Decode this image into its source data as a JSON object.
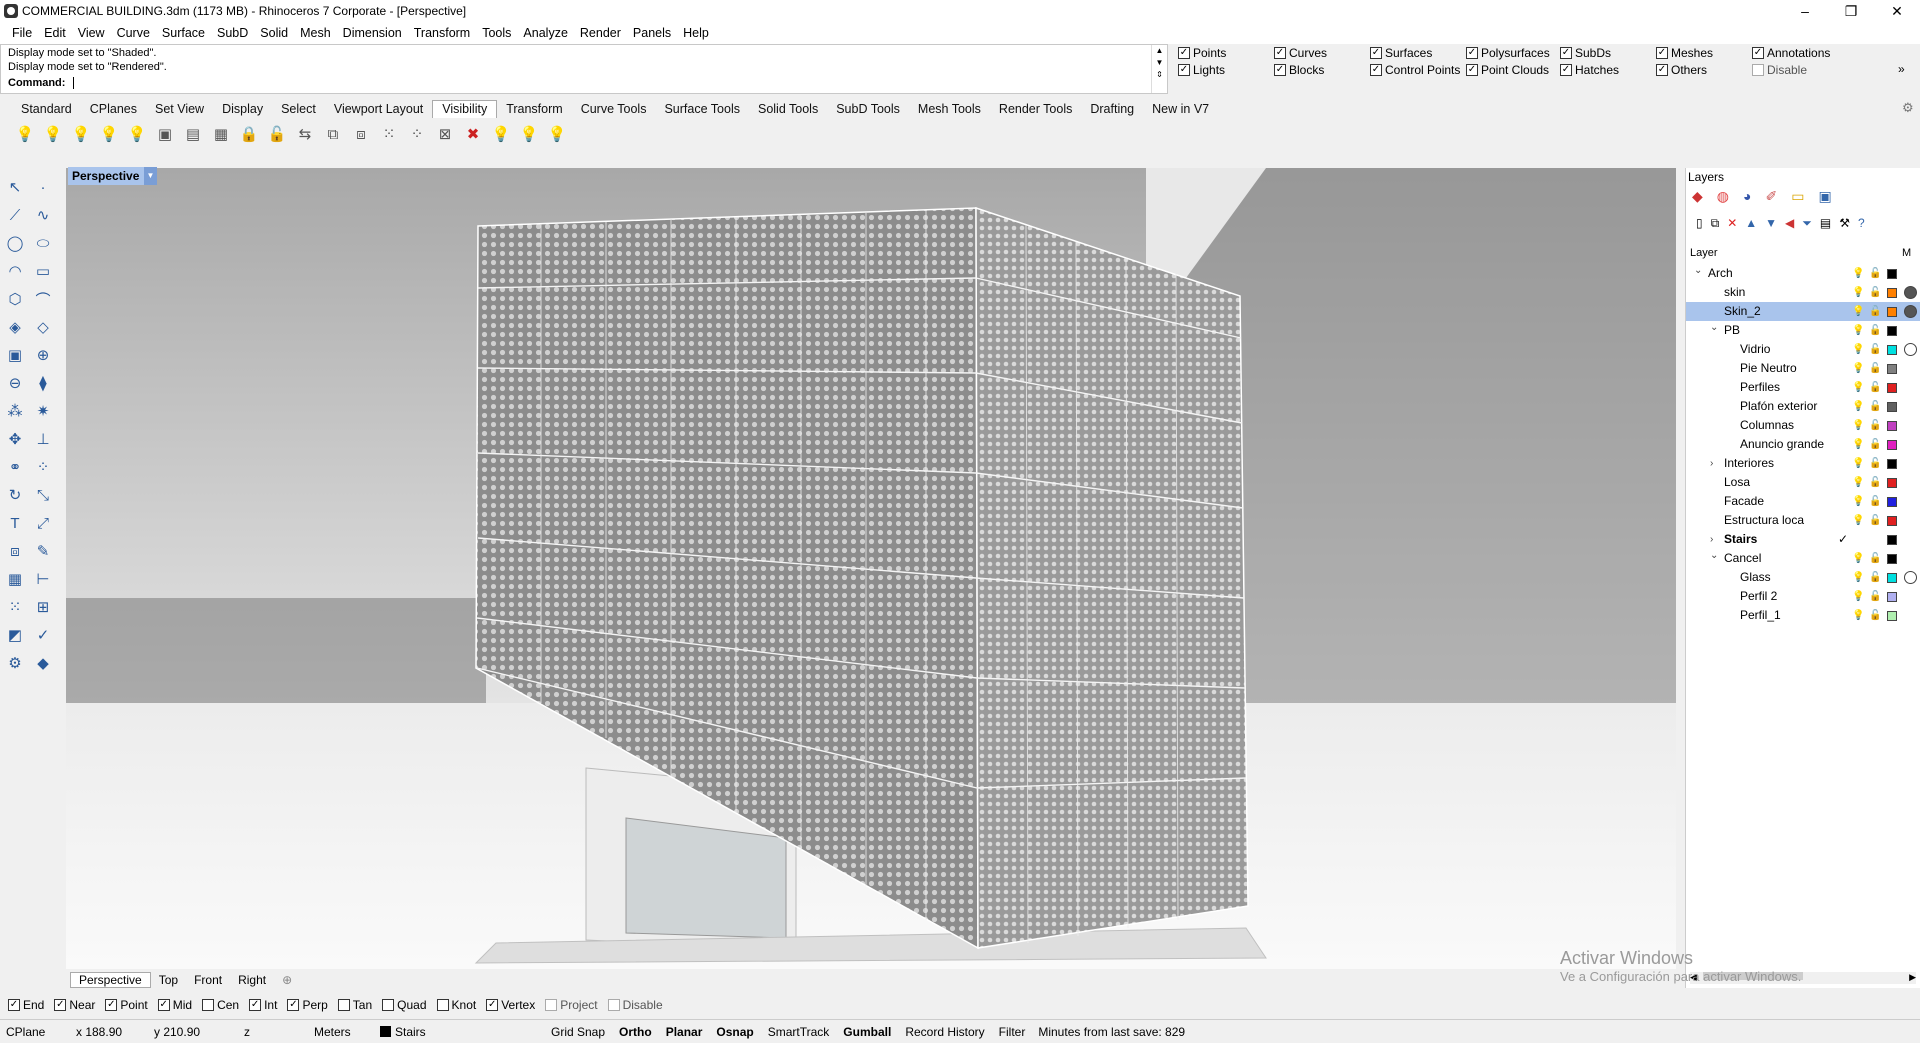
{
  "window": {
    "title": "COMMERCIAL BUILDING.3dm (1173 MB) - Rhinoceros 7 Corporate - [Perspective]",
    "controls": [
      "–",
      "❐",
      "✕"
    ]
  },
  "menu": [
    "File",
    "Edit",
    "View",
    "Curve",
    "Surface",
    "SubD",
    "Solid",
    "Mesh",
    "Dimension",
    "Transform",
    "Tools",
    "Analyze",
    "Render",
    "Panels",
    "Help"
  ],
  "command": {
    "history": [
      "Display mode set to \"Shaded\".",
      "Display mode set to \"Rendered\"."
    ],
    "prompt": "Command:"
  },
  "selection_filters": [
    {
      "label": "Points",
      "checked": true
    },
    {
      "label": "Curves",
      "checked": true
    },
    {
      "label": "Surfaces",
      "checked": true
    },
    {
      "label": "Polysurfaces",
      "checked": true
    },
    {
      "label": "SubDs",
      "checked": true
    },
    {
      "label": "Meshes",
      "checked": true
    },
    {
      "label": "Annotations",
      "checked": true
    },
    {
      "label": "Lights",
      "checked": true
    },
    {
      "label": "Blocks",
      "checked": true
    },
    {
      "label": "Control Points",
      "checked": true
    },
    {
      "label": "Point Clouds",
      "checked": true
    },
    {
      "label": "Hatches",
      "checked": true
    },
    {
      "label": "Others",
      "checked": true
    },
    {
      "label": "Disable",
      "checked": false
    }
  ],
  "toolbar_tabs": [
    "Standard",
    "CPlanes",
    "Set View",
    "Display",
    "Select",
    "Viewport Layout",
    "Visibility",
    "Transform",
    "Curve Tools",
    "Surface Tools",
    "Solid Tools",
    "SubD Tools",
    "Mesh Tools",
    "Render Tools",
    "Drafting",
    "New in V7"
  ],
  "active_toolbar_tab": "Visibility",
  "viewport": {
    "name": "Perspective"
  },
  "viewport_tabs": [
    "Perspective",
    "Top",
    "Front",
    "Right",
    "⊕"
  ],
  "layers_panel": {
    "title": "Layers",
    "column_header": "Layer",
    "material_header": "M",
    "rows": [
      {
        "name": "Arch",
        "indent": 0,
        "expander": "open",
        "color": "#000000",
        "material": "none"
      },
      {
        "name": "skin",
        "indent": 1,
        "color": "#ff8000",
        "material": "#555555"
      },
      {
        "name": "Skin_2",
        "indent": 1,
        "color": "#ff8000",
        "material": "#555555",
        "selected": true
      },
      {
        "name": "PB",
        "indent": 1,
        "expander": "open",
        "color": "#000000",
        "material": "none"
      },
      {
        "name": "Vidrio",
        "indent": 2,
        "color": "#00e0e0",
        "material": "#ffffff"
      },
      {
        "name": "Pie Neutro",
        "indent": 2,
        "color": "#808080",
        "material": "none"
      },
      {
        "name": "Perfiles",
        "indent": 2,
        "color": "#e02020",
        "material": "none"
      },
      {
        "name": "Plafón exterior",
        "indent": 2,
        "color": "#606060",
        "material": "none"
      },
      {
        "name": "Columnas",
        "indent": 2,
        "color": "#c040c0",
        "material": "none"
      },
      {
        "name": "Anuncio grande",
        "indent": 2,
        "color": "#e020c0",
        "material": "none"
      },
      {
        "name": "Interiores",
        "indent": 1,
        "expander": "closed",
        "color": "#000000",
        "material": "none"
      },
      {
        "name": "Losa",
        "indent": 1,
        "color": "#e02020",
        "material": "none"
      },
      {
        "name": "Facade",
        "indent": 1,
        "color": "#2020e0",
        "material": "none"
      },
      {
        "name": "Estructura loca",
        "indent": 1,
        "color": "#e02020",
        "material": "none"
      },
      {
        "name": "Stairs",
        "indent": 1,
        "expander": "closed",
        "current": true,
        "color": "#000000",
        "material": "none"
      },
      {
        "name": "Cancel",
        "indent": 1,
        "expander": "open",
        "color": "#000000",
        "material": "none"
      },
      {
        "name": "Glass",
        "indent": 2,
        "color": "#00e0e0",
        "material": "#ffffff"
      },
      {
        "name": "Perfil 2",
        "indent": 2,
        "color": "#b0b0f0",
        "material": "none"
      },
      {
        "name": "Perfil_1",
        "indent": 2,
        "color": "#b0f0b0",
        "material": "none"
      }
    ]
  },
  "osnaps": [
    {
      "label": "End",
      "checked": true
    },
    {
      "label": "Near",
      "checked": true
    },
    {
      "label": "Point",
      "checked": true
    },
    {
      "label": "Mid",
      "checked": true
    },
    {
      "label": "Cen",
      "checked": false
    },
    {
      "label": "Int",
      "checked": true
    },
    {
      "label": "Perp",
      "checked": true
    },
    {
      "label": "Tan",
      "checked": false
    },
    {
      "label": "Quad",
      "checked": false
    },
    {
      "label": "Knot",
      "checked": false
    },
    {
      "label": "Vertex",
      "checked": true
    },
    {
      "label": "Project",
      "checked": false,
      "disabled": true
    },
    {
      "label": "Disable",
      "checked": false,
      "disabled": true
    }
  ],
  "status": {
    "cplane": "CPlane",
    "x": "x 188.90",
    "y": "y 210.90",
    "z": "z",
    "units": "Meters",
    "layer": "Stairs",
    "toggles": [
      "Grid Snap",
      "Ortho",
      "Planar",
      "Osnap",
      "SmartTrack",
      "Gumball",
      "Record History",
      "Filter"
    ],
    "bold_toggles": [
      "Ortho",
      "Planar",
      "Osnap",
      "Gumball"
    ],
    "save_info": "Minutes from last save: 829"
  },
  "watermark": {
    "line1": "Activar Windows",
    "line2": "Ve a Configuración para activar Windows."
  }
}
